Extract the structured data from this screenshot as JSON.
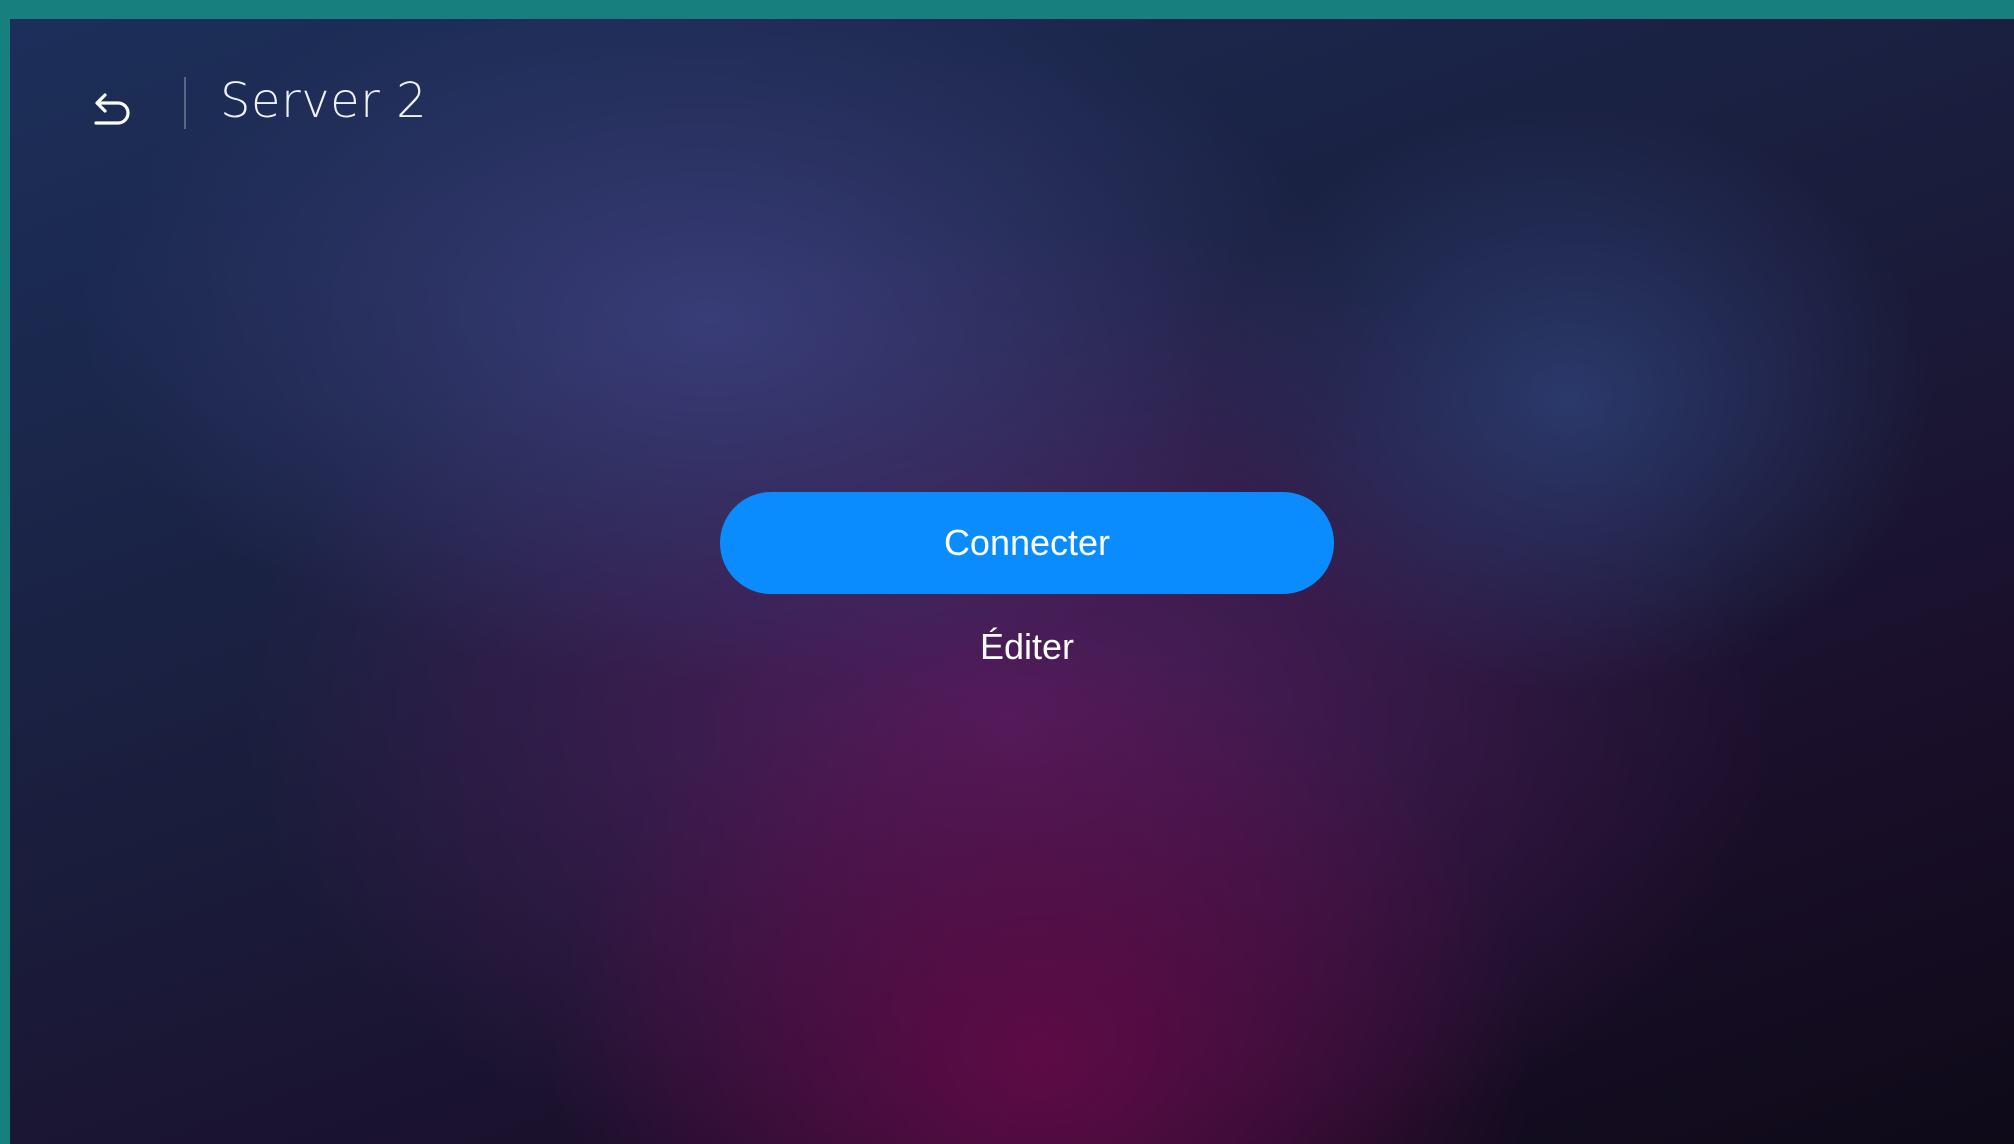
{
  "header": {
    "back_icon": "back-arrow-icon",
    "title": "Server 2"
  },
  "actions": {
    "connect_label": "Connecter",
    "edit_label": "Éditer"
  },
  "colors": {
    "accent": "#0a8cff",
    "window_border": "#17807e"
  }
}
